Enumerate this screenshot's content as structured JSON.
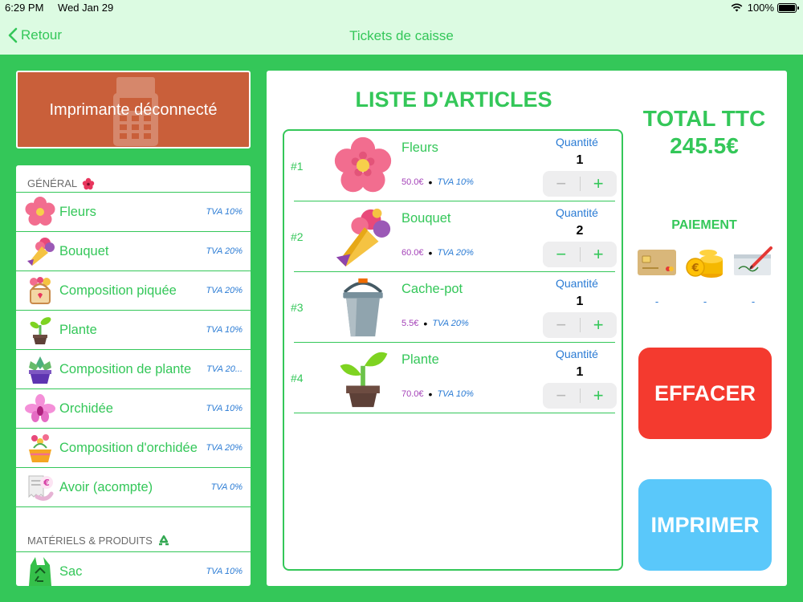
{
  "status": {
    "time": "6:29 PM",
    "date": "Wed Jan 29",
    "battery": "100%"
  },
  "nav": {
    "back_label": "Retour",
    "title": "Tickets de caisse"
  },
  "printer": {
    "status_text": "Imprimante déconnecté"
  },
  "catalog": {
    "sections": [
      {
        "title": "GÉNÉRAL",
        "icon": "hibiscus-icon",
        "items": [
          {
            "name": "Fleurs",
            "tva": "TVA 10%",
            "icon": "flower-icon"
          },
          {
            "name": "Bouquet",
            "tva": "TVA 20%",
            "icon": "bouquet-icon"
          },
          {
            "name": "Composition piquée",
            "tva": "TVA 20%",
            "icon": "flower-basket-icon"
          },
          {
            "name": "Plante",
            "tva": "TVA 10%",
            "icon": "sprout-icon"
          },
          {
            "name": "Composition de plante",
            "tva": "TVA 20...",
            "icon": "succulent-pot-icon"
          },
          {
            "name": "Orchidée",
            "tva": "TVA 10%",
            "icon": "orchid-icon"
          },
          {
            "name": "Composition d'orchidée",
            "tva": "TVA 20%",
            "icon": "orchid-pot-icon"
          },
          {
            "name": "Avoir (acompte)",
            "tva": "TVA 0%",
            "icon": "receipt-euro-icon"
          }
        ]
      },
      {
        "title": "MATÉRIELS & PRODUITS",
        "icon": "recycle-icon",
        "items": [
          {
            "name": "Sac",
            "tva": "TVA 10%",
            "icon": "recycle-bag-icon"
          }
        ]
      }
    ]
  },
  "articles": {
    "title": "LISTE D'ARTICLES",
    "quantity_label": "Quantité",
    "items": [
      {
        "index": "#1",
        "name": "Fleurs",
        "price": "50.0€",
        "tva": "TVA 10%",
        "quantity": "1",
        "icon": "flower-icon"
      },
      {
        "index": "#2",
        "name": "Bouquet",
        "price": "60.0€",
        "tva": "TVA 20%",
        "quantity": "2",
        "icon": "bouquet-icon"
      },
      {
        "index": "#3",
        "name": "Cache-pot",
        "price": "5.5€",
        "tva": "TVA 20%",
        "quantity": "1",
        "icon": "bucket-icon"
      },
      {
        "index": "#4",
        "name": "Plante",
        "price": "70.0€",
        "tva": "TVA 10%",
        "quantity": "1",
        "icon": "sprout-icon"
      }
    ]
  },
  "total": {
    "label": "TOTAL TTC",
    "value": "245.5€"
  },
  "payment": {
    "label": "PAIEMENT",
    "methods": [
      {
        "icon": "credit-card-icon",
        "value": "-"
      },
      {
        "icon": "coins-icon",
        "value": "-"
      },
      {
        "icon": "cheque-icon",
        "value": "-"
      }
    ]
  },
  "actions": {
    "clear_label": "EFFACER",
    "print_label": "IMPRIMER"
  },
  "colors": {
    "accent": "#34c759",
    "clear": "#f43a2f",
    "print": "#5ac8fa",
    "printer_card": "#c95f3a",
    "tva_text": "#2a7bd4",
    "price_text": "#a442b8"
  }
}
